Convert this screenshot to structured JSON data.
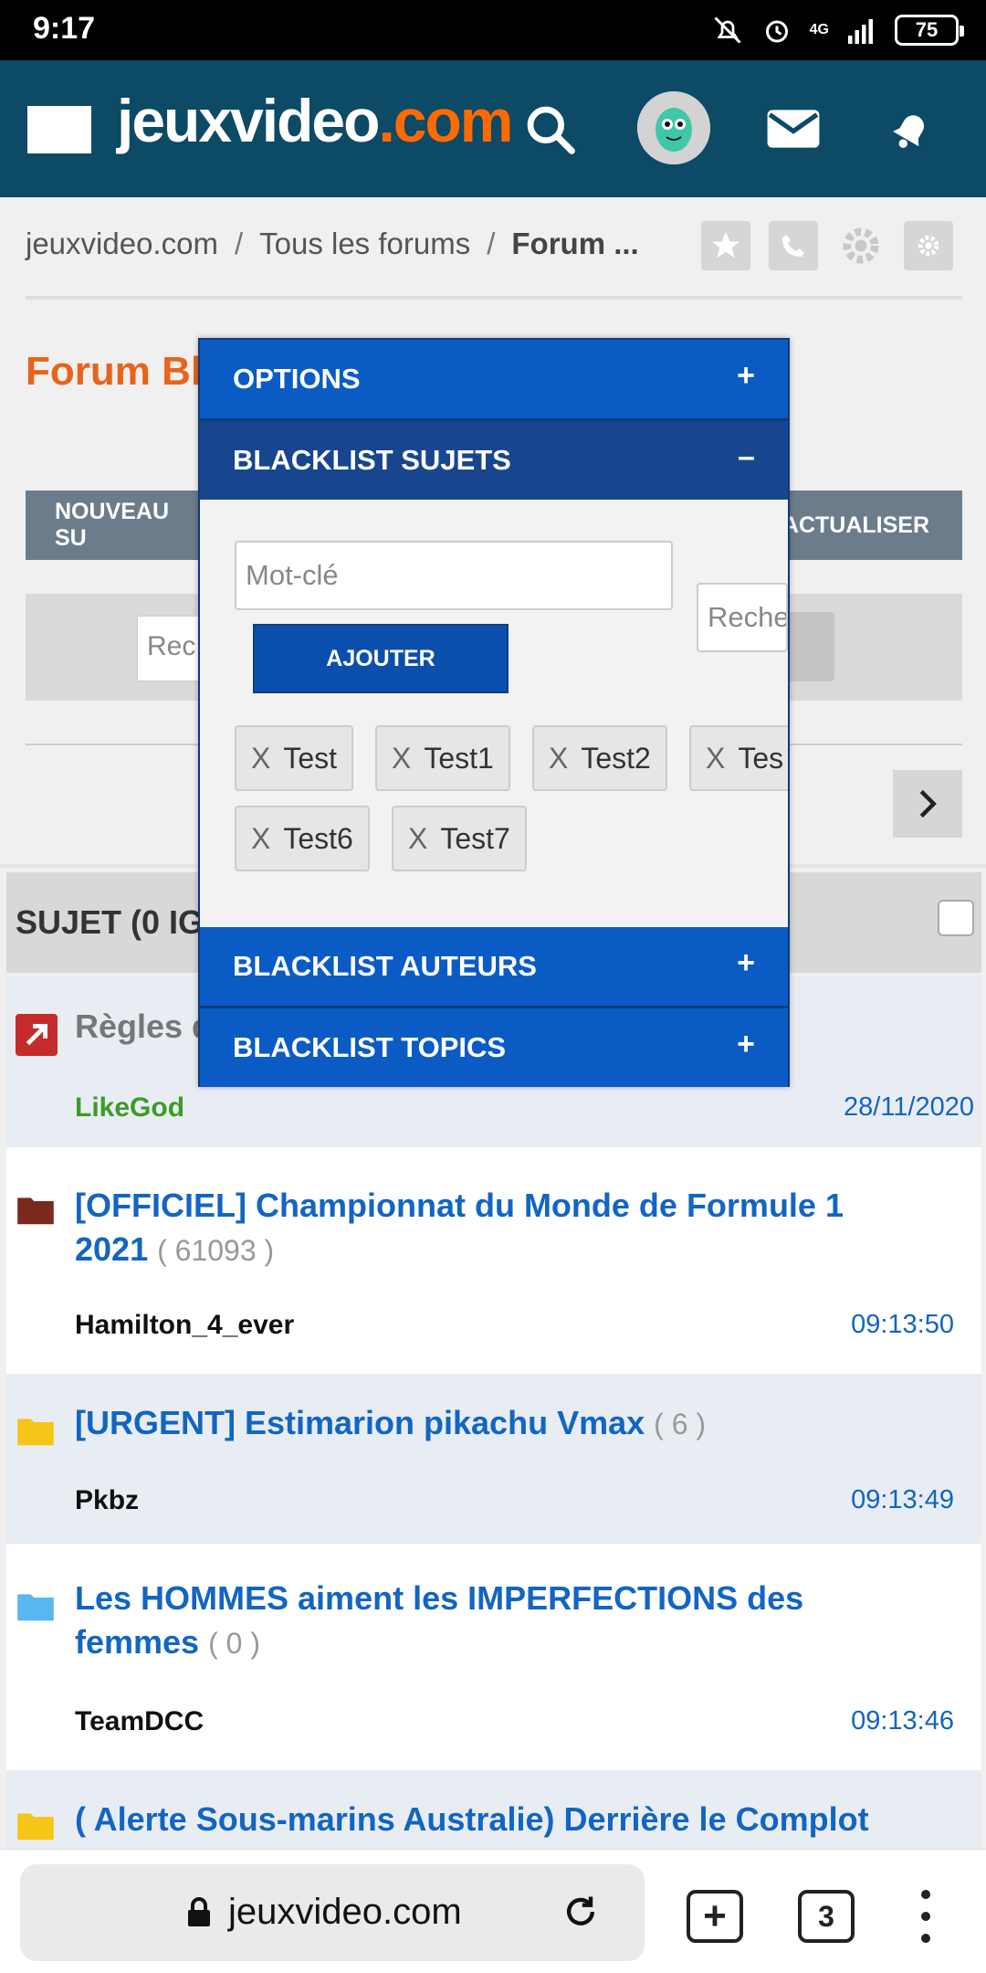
{
  "status_bar": {
    "time": "9:17",
    "battery": "75",
    "network": "4G"
  },
  "header": {
    "logo_main": "jeuxvideo",
    "logo_dot": ".com"
  },
  "breadcrumb": {
    "home": "jeuxvideo.com",
    "all_forums": "Tous les forums",
    "current": "Forum ..."
  },
  "forum": {
    "title": "Forum Bla"
  },
  "toolbar": {
    "new_topic": "NOUVEAU SU",
    "refresh": "ACTUALISER",
    "search_placeholder": "Rec"
  },
  "list": {
    "header_label": "SUJET (0 IG",
    "rows": [
      {
        "title": "Règles d",
        "count": "",
        "author": "LikeGod",
        "date": "28/11/2020",
        "icon": "pin-icon"
      },
      {
        "title": "[OFFICIEL] Championnat du Monde de Formule 1 2021",
        "count": "( 61093 )",
        "author": "Hamilton_4_ever",
        "date": "09:13:50",
        "icon": "folder-icon"
      },
      {
        "title": "[URGENT] Estimarion pikachu Vmax",
        "count": "( 6 )",
        "author": "Pkbz",
        "date": "09:13:49",
        "icon": "folder-icon"
      },
      {
        "title": "Les HOMMES aiment les IMPERFECTIONS des femmes",
        "count": "( 0 )",
        "author": "TeamDCC",
        "date": "09:13:46",
        "icon": "folder-icon"
      },
      {
        "title": "( Alerte Sous-marins Australie) Derrière le Complot",
        "count": "",
        "author": "",
        "date": "",
        "icon": "folder-icon"
      }
    ]
  },
  "modal": {
    "options_label": "OPTIONS",
    "options_toggle": "+",
    "blacklist_subjects_label": "BLACKLIST SUJETS",
    "blacklist_subjects_toggle": "–",
    "keyword_placeholder": "Mot-clé",
    "add_button": "AJOUTER",
    "search_placeholder": "Reche",
    "tags": [
      {
        "x": "X",
        "label": "Test"
      },
      {
        "x": "X",
        "label": "Test1"
      },
      {
        "x": "X",
        "label": "Test2"
      },
      {
        "x": "X",
        "label": "Tes"
      },
      {
        "x": "X",
        "label": "Test6"
      },
      {
        "x": "X",
        "label": "Test7"
      }
    ],
    "blacklist_authors_label": "BLACKLIST AUTEURS",
    "blacklist_authors_toggle": "+",
    "blacklist_topics_label": "BLACKLIST TOPICS",
    "blacklist_topics_toggle": "+"
  },
  "browser": {
    "url": "jeuxvideo.com",
    "tab_count": "3",
    "new_tab": "+"
  },
  "colors": {
    "header_bg": "#0c4a66",
    "accent_orange": "#e8641b",
    "link_blue": "#1265c3",
    "modal_blue": "#0b5bc4",
    "modal_dark": "#18468e",
    "author_green": "#3d9b26"
  }
}
